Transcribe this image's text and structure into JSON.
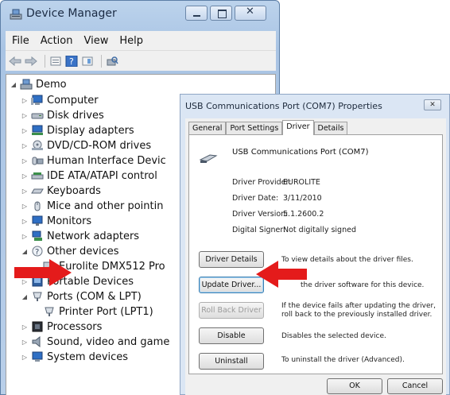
{
  "device_manager": {
    "title": "Device Manager",
    "menu": [
      "File",
      "Action",
      "View",
      "Help"
    ],
    "tree": {
      "root": "Demo",
      "items": [
        {
          "label": "Computer",
          "icon": "computer-icon"
        },
        {
          "label": "Disk drives",
          "icon": "disk-drive-icon"
        },
        {
          "label": "Display adapters",
          "icon": "display-adapter-icon"
        },
        {
          "label": "DVD/CD-ROM drives",
          "icon": "dvd-drive-icon"
        },
        {
          "label": "Human Interface Devic",
          "icon": "hid-icon"
        },
        {
          "label": "IDE ATA/ATAPI control",
          "icon": "ide-controller-icon"
        },
        {
          "label": "Keyboards",
          "icon": "keyboard-icon"
        },
        {
          "label": "Mice and other pointin",
          "icon": "mouse-icon"
        },
        {
          "label": "Monitors",
          "icon": "monitor-icon"
        },
        {
          "label": "Network adapters",
          "icon": "network-adapter-icon"
        },
        {
          "label": "Other devices",
          "icon": "other-devices-icon"
        },
        {
          "label": "Eurolite DMX512 Pro",
          "icon": "warning-device-icon"
        },
        {
          "label": "Portable Devices",
          "icon": "portable-device-icon"
        },
        {
          "label": "Ports (COM & LPT)",
          "icon": "port-icon"
        },
        {
          "label": "Printer Port (LPT1)",
          "icon": "printer-port-icon"
        },
        {
          "label": "Processors",
          "icon": "processor-icon"
        },
        {
          "label": "Sound, video and game",
          "icon": "sound-icon"
        },
        {
          "label": "System devices",
          "icon": "system-devices-icon"
        }
      ]
    }
  },
  "properties": {
    "title": "USB Communications Port (COM7) Properties",
    "tabs": [
      "General",
      "Port Settings",
      "Driver",
      "Details"
    ],
    "active_tab": "Driver",
    "device_name": "USB Communications Port (COM7)",
    "info": {
      "provider_label": "Driver Provider:",
      "provider_value": "EUROLITE",
      "date_label": "Driver Date:",
      "date_value": "3/11/2010",
      "version_label": "Driver Version:",
      "version_value": "5.1.2600.2",
      "signer_label": "Digital Signer:",
      "signer_value": "Not digitally signed"
    },
    "buttons": {
      "details_label": "Driver Details",
      "details_desc": "To view details about the driver files.",
      "update_label": "Update Driver...",
      "update_desc": "the driver software for this device.",
      "rollback_label": "Roll Back Driver",
      "rollback_desc": "If the device fails after updating the driver, roll back to the previously installed driver.",
      "disable_label": "Disable",
      "disable_desc": "Disables the selected device.",
      "uninstall_label": "Uninstall",
      "uninstall_desc": "To uninstall the driver (Advanced).",
      "ok_label": "OK",
      "cancel_label": "Cancel"
    }
  },
  "colors": {
    "arrow": "#e41b1b",
    "window_frame": "#a9c4e4"
  }
}
